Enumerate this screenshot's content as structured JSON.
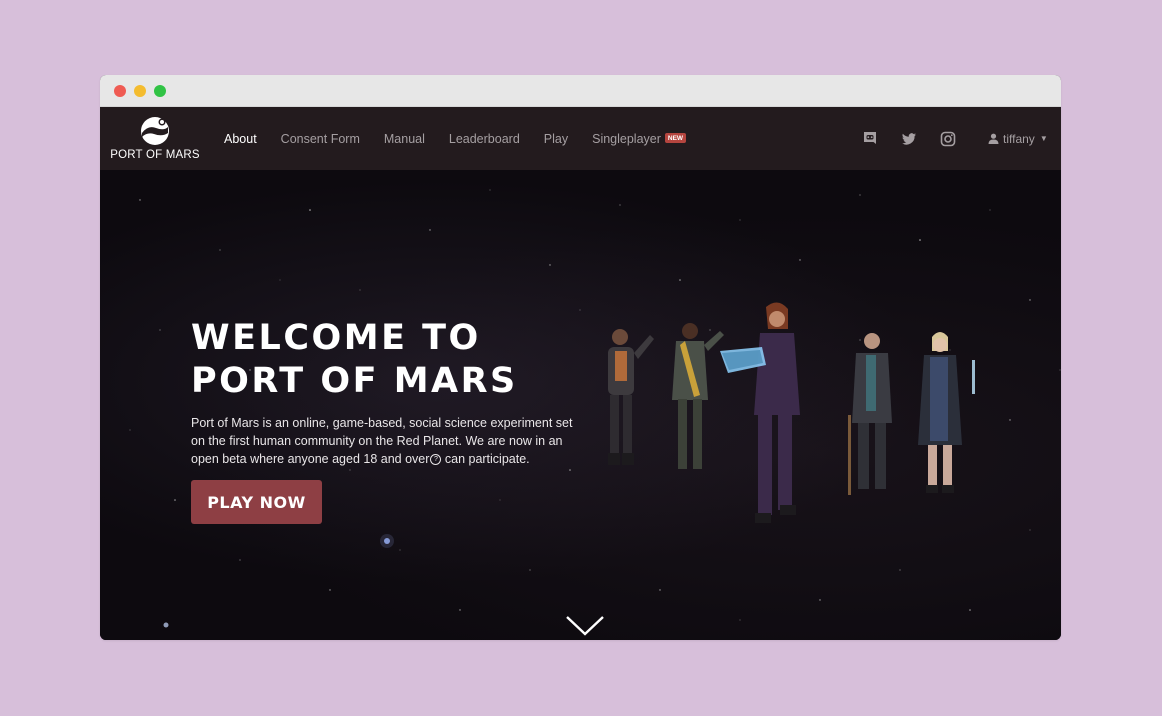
{
  "brand": {
    "name": "PORT OF MARS",
    "logo_icon": "planet-moon-logo"
  },
  "nav": {
    "items": [
      {
        "label": "About",
        "active": true
      },
      {
        "label": "Consent Form",
        "active": false
      },
      {
        "label": "Manual",
        "active": false
      },
      {
        "label": "Leaderboard",
        "active": false
      },
      {
        "label": "Play",
        "active": false
      },
      {
        "label": "Singleplayer",
        "active": false,
        "badge": "NEW"
      }
    ],
    "social": [
      "discord-icon",
      "twitter-icon",
      "instagram-icon"
    ],
    "user": {
      "name": "tiffany",
      "icon": "user-icon"
    }
  },
  "hero": {
    "title_line1": "WELCOME TO",
    "title_line2": "PORT OF MARS",
    "description_part1": "Port of Mars is an online, game-based, social science experiment set on the first human community on the Red Planet. We are now in an open beta where anyone aged 18 and over",
    "description_part2": " can participate.",
    "cta_label": "PLAY NOW"
  },
  "colors": {
    "page_background": "#d7bfda",
    "navbar": "#231b1e",
    "cta": "#8e3f44",
    "badge": "#b5453f",
    "nav_inactive": "#a59fa2"
  }
}
